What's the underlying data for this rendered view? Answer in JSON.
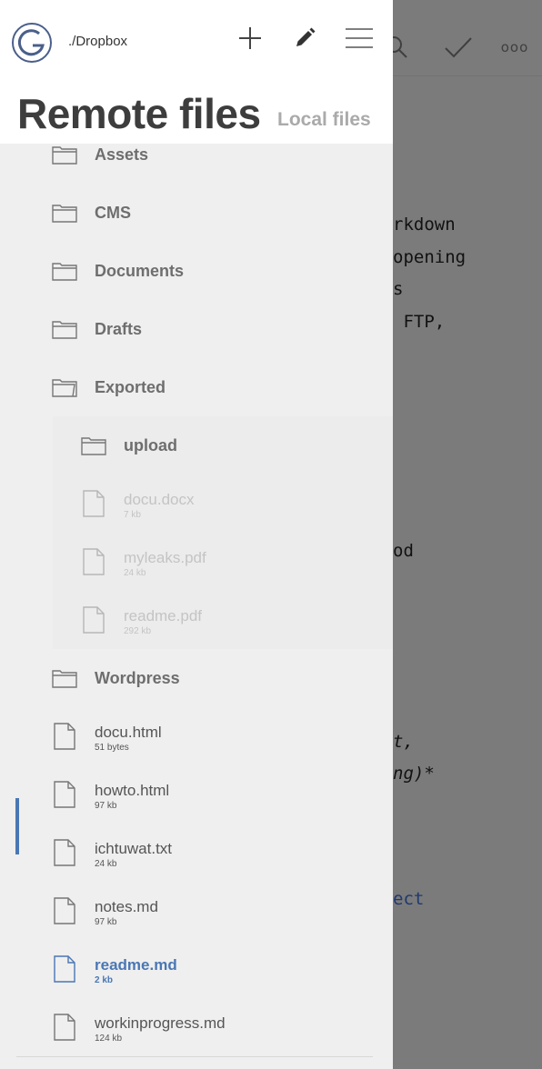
{
  "editor": {
    "lines": [
      "rkdown",
      "opening",
      "s",
      " FTP,",
      "od",
      "t,",
      "ng)*",
      "ect"
    ],
    "icons": [
      "search-icon",
      "check-icon",
      "more-icon"
    ],
    "more_label": "ooo"
  },
  "header": {
    "path": "./Dropbox",
    "title": "Remote files",
    "tab_local": "Local files",
    "icons": [
      "app-logo",
      "plus-icon",
      "pencil-icon",
      "hamburger-menu-icon"
    ]
  },
  "items": [
    {
      "kind": "folder",
      "name": "Assets",
      "level": 0
    },
    {
      "kind": "folder",
      "name": "CMS",
      "level": 0
    },
    {
      "kind": "folder",
      "name": "Documents",
      "level": 0
    },
    {
      "kind": "folder",
      "name": "Drafts",
      "level": 0
    },
    {
      "kind": "folder",
      "name": "Exported",
      "level": 0,
      "open": true
    },
    {
      "kind": "folder",
      "name": "upload",
      "level": 1
    },
    {
      "kind": "file",
      "name": "docu.docx",
      "size": "7 kb",
      "level": 1,
      "dim": true
    },
    {
      "kind": "file",
      "name": "myleaks.pdf",
      "size": "24 kb",
      "level": 1,
      "dim": true
    },
    {
      "kind": "file",
      "name": "readme.pdf",
      "size": "292 kb",
      "level": 1,
      "dim": true
    },
    {
      "kind": "folder",
      "name": "Wordpress",
      "level": 0
    },
    {
      "kind": "file",
      "name": "docu.html",
      "size": "51 bytes",
      "level": 0
    },
    {
      "kind": "file",
      "name": "howto.html",
      "size": "97 kb",
      "level": 0
    },
    {
      "kind": "file",
      "name": "ichtuwat.txt",
      "size": "24 kb",
      "level": 0
    },
    {
      "kind": "file",
      "name": "notes.md",
      "size": "97 kb",
      "level": 0
    },
    {
      "kind": "file",
      "name": "readme.md",
      "size": "2 kb",
      "level": 0,
      "selected": true
    },
    {
      "kind": "file",
      "name": "workinprogress.md",
      "size": "124 kb",
      "level": 0
    }
  ],
  "colors": {
    "accent": "#4a77b4",
    "overlay": "#7b7b7b"
  }
}
